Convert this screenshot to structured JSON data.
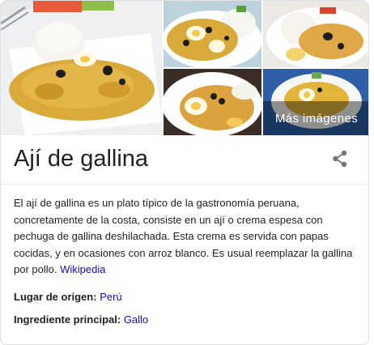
{
  "images": {
    "more_label": "Más imágenes"
  },
  "title": "Ají de gallina",
  "description": {
    "text": "El ají de gallina es un plato típico de la gastronomía peruana, concretamente de la costa,  consiste en un ají o crema espesa con pechuga de gallina deshilachada. Esta crema es servida con papas cocidas, y en ocasiones con arroz blanco. Es usual reemplazar la gallina por pollo. ",
    "source_link": "Wikipedia"
  },
  "facts": {
    "origin_label": "Lugar de origen:",
    "origin_value": "Perú",
    "ingredient_label": "Ingrediente principal:",
    "ingredient_value": "Gallo"
  },
  "icons": {
    "share": "share-icon"
  },
  "colors": {
    "link": "#1a0dab",
    "sauce": "#d8a52a",
    "border": "#dfe1e5"
  }
}
